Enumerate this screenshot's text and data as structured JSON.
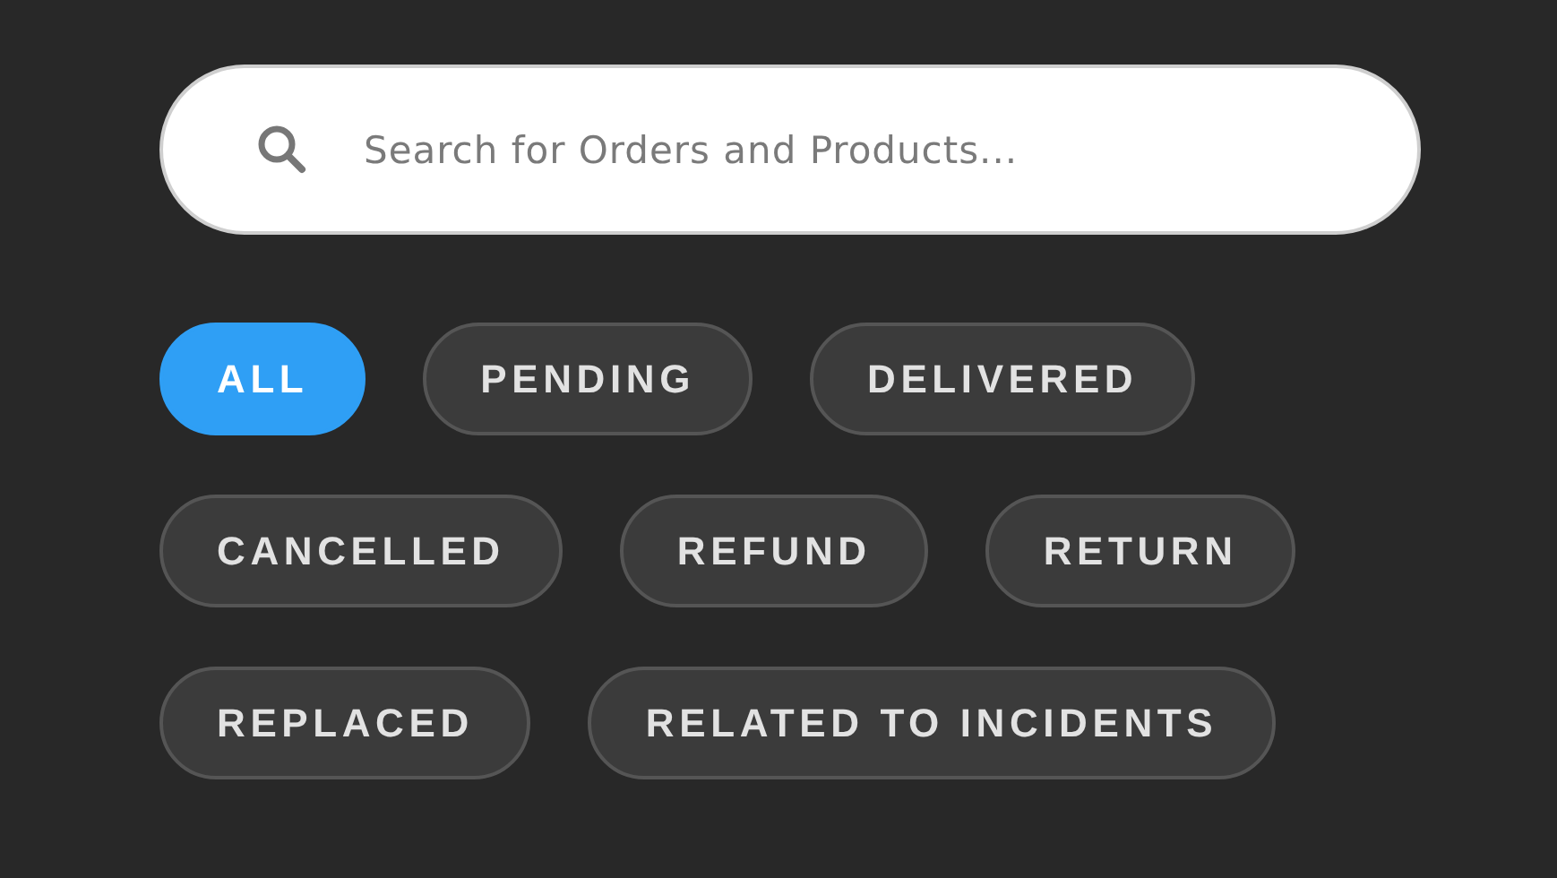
{
  "search": {
    "placeholder": "Search for Orders and Products..."
  },
  "filter_rows": [
    {
      "chips": [
        {
          "label": "ALL",
          "selected": true
        },
        {
          "label": "PENDING",
          "selected": false
        },
        {
          "label": "DELIVERED",
          "selected": false
        }
      ]
    },
    {
      "chips": [
        {
          "label": "CANCELLED",
          "selected": false
        },
        {
          "label": "REFUND",
          "selected": false
        },
        {
          "label": "RETURN",
          "selected": false
        }
      ]
    },
    {
      "chips": [
        {
          "label": "REPLACED",
          "selected": false
        },
        {
          "label": "RELATED TO INCIDENTS",
          "selected": false
        }
      ]
    }
  ]
}
